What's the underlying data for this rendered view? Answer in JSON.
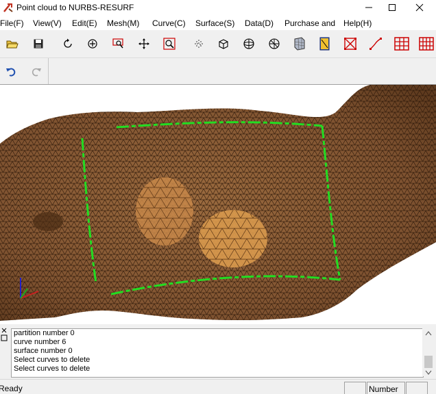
{
  "window": {
    "title": "Point cloud to NURBS-RESURF",
    "minimize_icon": "minimize-icon",
    "maximize_icon": "maximize-icon",
    "close_icon": "close-icon"
  },
  "menu": [
    {
      "label": "File(F)"
    },
    {
      "label": "View(V)"
    },
    {
      "label": "Edit(E)"
    },
    {
      "label": "Mesh(M)"
    },
    {
      "label": "Curve(C)"
    },
    {
      "label": "Surface(S)"
    },
    {
      "label": "Data(D)"
    },
    {
      "label": "Purchase and"
    },
    {
      "label": "Help(H)"
    }
  ],
  "toolbar": {
    "icons": [
      "open-folder-icon",
      "save-icon",
      "rotate-icon",
      "pan-icon",
      "zoom-window-icon",
      "move-icon",
      "zoom-fit-icon",
      "point-cloud-icon",
      "cube-icon",
      "sphere-icon",
      "globe-icon",
      "mesh-object-icon",
      "curve-object-icon",
      "delete-box-icon",
      "curve-line-icon",
      "grid-red-icon",
      "grid-red-2-icon"
    ],
    "undo_icon": "undo-icon",
    "redo_icon": "redo-icon"
  },
  "output": {
    "lines": [
      "partition number 0",
      "curve number 6",
      "surface number 0",
      "Select curves to delete",
      "Select curves to delete"
    ]
  },
  "status": {
    "ready": "Ready",
    "number_label": "Number"
  },
  "colors": {
    "mesh_base": "#8a5a33",
    "mesh_highlight": "#d99a4e",
    "curve_green": "#22dd22",
    "icon_red": "#cc0000"
  }
}
